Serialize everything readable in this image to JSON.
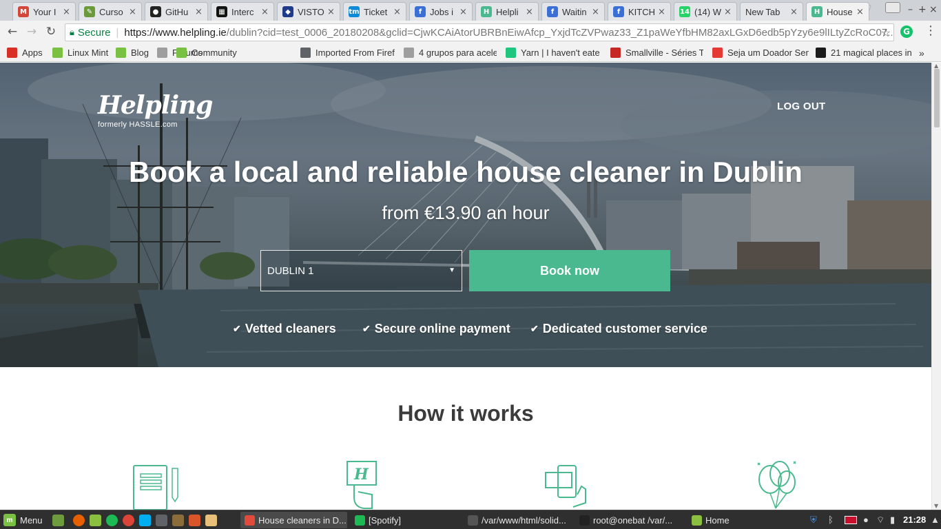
{
  "browser": {
    "tabs": [
      {
        "title": "Your I",
        "icon": "gmail-icon",
        "color": "#d44638",
        "glyph": "M"
      },
      {
        "title": "Curso",
        "icon": "leaf-icon",
        "color": "#6a9a3a",
        "glyph": "✎"
      },
      {
        "title": "GitHu",
        "icon": "github-icon",
        "color": "#222222",
        "glyph": "●"
      },
      {
        "title": "Interc",
        "icon": "news-icon",
        "color": "#111111",
        "glyph": "▦"
      },
      {
        "title": "VISTO",
        "icon": "flag-icon",
        "color": "#1f3a8a",
        "glyph": "◆"
      },
      {
        "title": "Ticket",
        "icon": "ticketmaster-icon",
        "color": "#0a8ad8",
        "glyph": "tm"
      },
      {
        "title": "Jobs i",
        "icon": "job-icon",
        "color": "#3b6fd8",
        "glyph": "f"
      },
      {
        "title": "Helpli",
        "icon": "helpling-icon",
        "color": "#4ab98f",
        "glyph": "H"
      },
      {
        "title": "Waitin",
        "icon": "job-icon",
        "color": "#3b6fd8",
        "glyph": "f"
      },
      {
        "title": "KITCH",
        "icon": "job-icon",
        "color": "#3b6fd8",
        "glyph": "f"
      },
      {
        "title": "(14) W",
        "icon": "whatsapp-icon",
        "color": "#25d366",
        "glyph": "14"
      },
      {
        "title": "New Tab",
        "icon": "",
        "color": "",
        "glyph": ""
      },
      {
        "title": "House",
        "icon": "helpling-icon",
        "color": "#4ab98f",
        "glyph": "H"
      }
    ],
    "address": {
      "secure_label": "Secure",
      "host": "https://www.helpling.ie",
      "path": "/dublin?cid=test_0006_20180208&gclid=CjwKCAiAtorUBRBnEiwAfcp_YxjdTcZVPwaz33_Z1paWeYfbHM82axLGxD6edb5pYzy6e9lILtyZcRoC07..."
    },
    "bookmarks": [
      {
        "label": "Apps",
        "icon": "apps-grid-icon",
        "color": "#d93025"
      },
      {
        "label": "Linux Mint",
        "icon": "mint-icon",
        "color": "#7ac143"
      },
      {
        "label": "Blog",
        "icon": "mint-icon",
        "color": "#7ac143"
      },
      {
        "label": "Forums",
        "icon": "page-icon",
        "color": "#9e9e9e"
      },
      {
        "label": "Community",
        "icon": "mint-icon",
        "color": "#7ac143"
      },
      {
        "label": "Imported From Firef",
        "icon": "folder-icon",
        "color": "#5f6368"
      },
      {
        "label": "4 grupos para acele",
        "icon": "page-icon",
        "color": "#9e9e9e"
      },
      {
        "label": "Yarn | I haven't eate",
        "icon": "yarn-icon",
        "color": "#1ec77d"
      },
      {
        "label": "Smallville - Séries To",
        "icon": "popcorn-icon",
        "color": "#c62828"
      },
      {
        "label": "Seja um Doador Sen",
        "icon": "heart-icon",
        "color": "#e53935"
      },
      {
        "label": "21 magical places in",
        "icon": "spider-icon",
        "color": "#1b1b1b"
      }
    ],
    "bookmarks_more": "»"
  },
  "site": {
    "logo_word": "Helpling",
    "logo_sub": "formerly HASSLE.com",
    "logout": "LOG OUT",
    "headline": "Book a local and reliable house cleaner in Dublin",
    "subline": "from €13.90 an hour",
    "area_select": "DUBLIN 1",
    "book_button": "Book now",
    "usps": [
      "Vetted cleaners",
      "Secure online payment",
      "Dedicated customer service"
    ],
    "how_title": "How it works",
    "accent_color": "#4ab98f"
  },
  "taskbar": {
    "menu_label": "Menu",
    "tasks": [
      {
        "label": "House cleaners in D...",
        "icon": "chrome-icon",
        "color": "#e24a3b"
      },
      {
        "label": "[Spotify]",
        "icon": "spotify-icon",
        "color": "#1db954"
      },
      {
        "label": "/var/www/html/solid...",
        "icon": "terminal-icon",
        "color": "#555555"
      },
      {
        "label": "root@onebat /var/...",
        "icon": "terminal-icon",
        "color": "#222222"
      },
      {
        "label": "Home",
        "icon": "folder-icon",
        "color": "#8bbf3f"
      }
    ],
    "clock": "21:28"
  }
}
